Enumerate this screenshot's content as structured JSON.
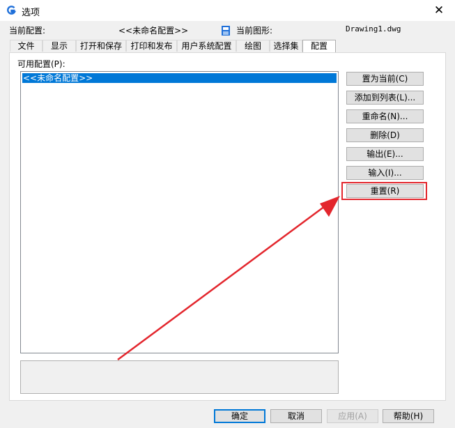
{
  "window": {
    "title": "选项",
    "close_glyph": "✕"
  },
  "info": {
    "current_profile_label": "当前配置:",
    "current_profile_value": "<<未命名配置>>",
    "current_drawing_label": "当前图形:",
    "current_drawing_value": "Drawing1.dwg"
  },
  "tabs": [
    {
      "label": "文件"
    },
    {
      "label": "显示"
    },
    {
      "label": "打开和保存"
    },
    {
      "label": "打印和发布"
    },
    {
      "label": "用户系统配置"
    },
    {
      "label": "绘图"
    },
    {
      "label": "选择集"
    },
    {
      "label": "配置",
      "active": true
    }
  ],
  "profiles": {
    "label": "可用配置(P):",
    "items": [
      "<<未命名配置>>"
    ]
  },
  "side_buttons": {
    "set_current": "置为当前(C)",
    "add_to_list": "添加到列表(L)...",
    "rename": "重命名(N)...",
    "delete": "删除(D)",
    "export": "输出(E)...",
    "import": "输入(I)...",
    "reset": "重置(R)"
  },
  "footer": {
    "ok": "确定",
    "cancel": "取消",
    "apply": "应用(A)",
    "help": "帮助(H)"
  },
  "colors": {
    "annotation_red": "#e3262d",
    "selection_blue": "#0078d7",
    "logo_blue": "#1e6fd9"
  }
}
